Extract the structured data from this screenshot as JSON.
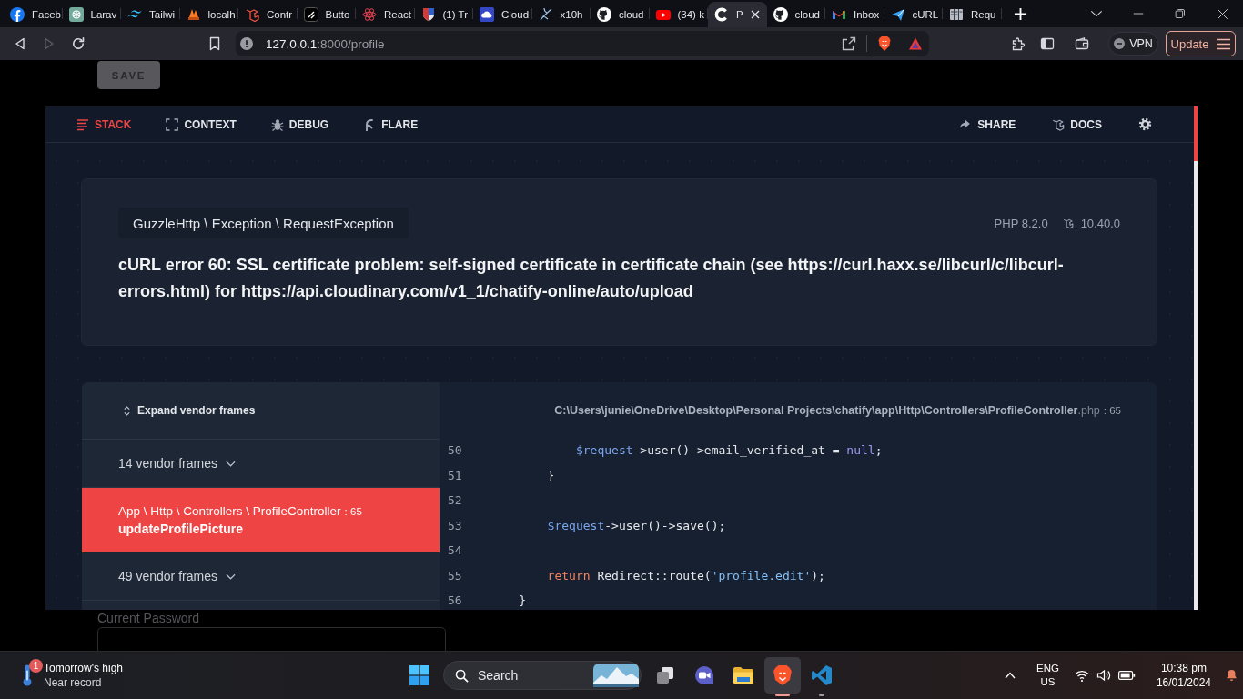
{
  "browser": {
    "tabs": [
      {
        "kind": "facebook",
        "title": "Faceb",
        "selected": false
      },
      {
        "kind": "chatgpt",
        "title": "Larav",
        "selected": false
      },
      {
        "kind": "tailwind",
        "title": "Tailwi",
        "selected": false
      },
      {
        "kind": "xampp",
        "title": "localh",
        "selected": false
      },
      {
        "kind": "laravel",
        "title": "Contr",
        "selected": false
      },
      {
        "kind": "slash",
        "title": "Butto",
        "selected": false
      },
      {
        "kind": "react",
        "title": "React",
        "selected": false
      },
      {
        "kind": "shield",
        "title": "(1) Tr",
        "selected": false
      },
      {
        "kind": "cloudinary",
        "title": "Cloud",
        "selected": false
      },
      {
        "kind": "wisp",
        "title": "x10h",
        "selected": false
      },
      {
        "kind": "github",
        "title": "cloud",
        "selected": false
      },
      {
        "kind": "youtube",
        "title": "(34) k",
        "selected": false
      },
      {
        "kind": "ignition",
        "title": "P",
        "selected": true
      },
      {
        "kind": "github",
        "title": "cloud",
        "selected": false
      },
      {
        "kind": "gmail",
        "title": "Inbox",
        "selected": false
      },
      {
        "kind": "plane",
        "title": "cURL",
        "selected": false
      },
      {
        "kind": "columns",
        "title": "Requ",
        "selected": false
      }
    ],
    "nav_buttons": [
      {
        "kind": "back",
        "disabled": false
      },
      {
        "kind": "forward",
        "disabled": true
      },
      {
        "kind": "reload",
        "disabled": false
      }
    ],
    "address": {
      "host": "127.0.0.1",
      "path": ":8000/profile"
    },
    "vpn": {
      "label": "VPN",
      "connected": false
    },
    "update_button": "Update"
  },
  "page": {
    "save_button": "SAVE",
    "current_password_label": "Current Password"
  },
  "error_page": {
    "nav": [
      {
        "kind": "stack",
        "label": "STACK",
        "selected": true
      },
      {
        "kind": "context",
        "label": "CONTEXT",
        "selected": false
      },
      {
        "kind": "debug",
        "label": "DEBUG",
        "selected": false
      },
      {
        "kind": "flare",
        "label": "FLARE",
        "selected": false
      }
    ],
    "actions": [
      {
        "kind": "share",
        "label": "SHARE"
      },
      {
        "kind": "docs",
        "label": "DOCS"
      },
      {
        "kind": "settings"
      }
    ],
    "exception": {
      "class": "GuzzleHttp \\ Exception \\ RequestException",
      "php_version": "PHP 8.2.0",
      "laravel_version": "10.40.0",
      "message": "cURL error 60: SSL certificate problem: self-signed certificate in certificate chain (see https://curl.haxx.se/libcurl/c/libcurl-errors.html) for https://api.cloudinary.com/v1_1/chatify-online/auto/upload"
    },
    "stack": {
      "expand_label": "Expand vendor frames",
      "frames": [
        {
          "kind": "vendor",
          "label": "14 vendor frames",
          "selected": false
        },
        {
          "kind": "app",
          "class": "App \\ Http \\ Controllers \\ ProfileController",
          "line": ": 65",
          "method": "updateProfilePicture",
          "selected": true
        },
        {
          "kind": "vendor",
          "label": "49 vendor frames",
          "selected": false
        }
      ]
    },
    "code": {
      "file": "C:\\Users\\junie\\OneDrive\\Desktop\\Personal Projects\\chatify\\app\\Http\\Controllers\\ProfileController",
      "extension": ".php",
      "line": ": 65",
      "lines": [
        {
          "number": "50",
          "tokens": [
            {
              "text": "            $request",
              "kind": "variable"
            },
            {
              "text": "->user()->email_verified_at = ",
              "kind": "plain"
            },
            {
              "text": "null",
              "kind": "constant"
            },
            {
              "text": ";",
              "kind": "plain"
            }
          ]
        },
        {
          "number": "51",
          "tokens": [
            {
              "text": "        }",
              "kind": "plain"
            }
          ]
        },
        {
          "number": "52"
        },
        {
          "number": "53",
          "tokens": [
            {
              "text": "        $request",
              "kind": "variable"
            },
            {
              "text": "->user()->save();",
              "kind": "plain"
            }
          ]
        },
        {
          "number": "54"
        },
        {
          "number": "55",
          "tokens": [
            {
              "text": "        return",
              "kind": "keyword"
            },
            {
              "text": " Redirect::route(",
              "kind": "plain"
            },
            {
              "text": "'profile.edit'",
              "kind": "string"
            },
            {
              "text": ");",
              "kind": "plain"
            }
          ]
        },
        {
          "number": "56",
          "tokens": [
            {
              "text": "    }",
              "kind": "plain"
            }
          ]
        }
      ]
    }
  },
  "taskbar": {
    "weather": {
      "badge": "1",
      "title": "Tomorrow's high",
      "subtitle": "Near record"
    },
    "search": {
      "placeholder": "Search"
    },
    "apps": [
      {
        "kind": "taskview",
        "running": false,
        "selected": false
      },
      {
        "kind": "meet",
        "running": false,
        "selected": false
      },
      {
        "kind": "explorer",
        "running": false,
        "selected": false
      },
      {
        "kind": "brave",
        "running": true,
        "selected": true
      },
      {
        "kind": "vscode",
        "running": true,
        "selected": false
      }
    ],
    "language": [
      "ENG",
      "US"
    ],
    "time": "10:38 pm",
    "date": "16/01/2024"
  }
}
